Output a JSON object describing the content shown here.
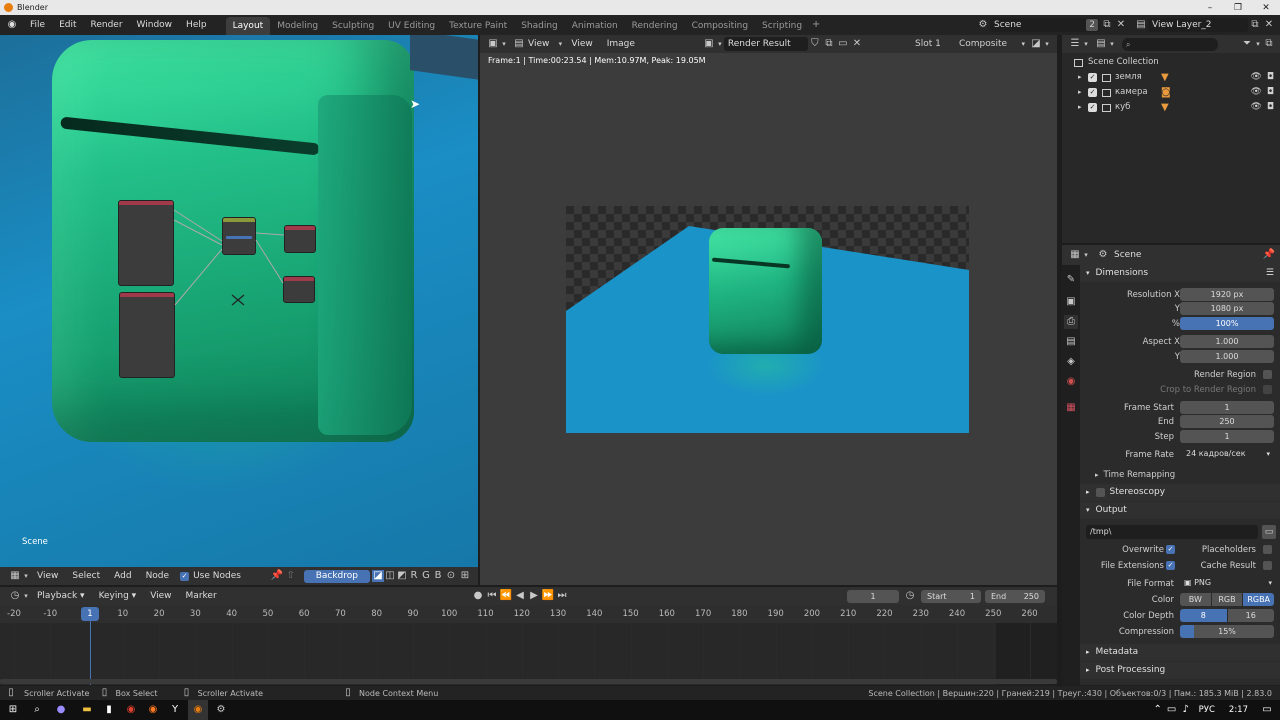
{
  "window": {
    "title": "Blender"
  },
  "menu": [
    "File",
    "Edit",
    "Render",
    "Window",
    "Help"
  ],
  "workspaces": [
    {
      "label": "Layout",
      "active": true
    },
    {
      "label": "Modeling"
    },
    {
      "label": "Sculpting"
    },
    {
      "label": "UV Editing"
    },
    {
      "label": "Texture Paint"
    },
    {
      "label": "Shading"
    },
    {
      "label": "Animation"
    },
    {
      "label": "Rendering"
    },
    {
      "label": "Compositing"
    },
    {
      "label": "Scripting"
    }
  ],
  "scene_selector": {
    "value": "Scene",
    "users": "2"
  },
  "view_layer": {
    "value": "View Layer_2"
  },
  "node_editor": {
    "scene_label": "Scene",
    "header": {
      "view": "View",
      "select": "Select",
      "add": "Add",
      "node": "Node",
      "use_nodes": "Use Nodes",
      "backdrop": "Backdrop"
    }
  },
  "image_editor": {
    "view": "View",
    "view2": "View",
    "image": "Image",
    "image_name": "Render Result",
    "slot": "Slot 1",
    "pass": "Composite",
    "info": "Frame:1 | Time:00:23.54 | Mem:10.97M, Peak: 19.05M"
  },
  "outliner": {
    "collection": "Scene Collection",
    "items": [
      {
        "name": "земля",
        "icon": "mesh"
      },
      {
        "name": "камера",
        "icon": "camera"
      },
      {
        "name": "куб",
        "icon": "mesh"
      }
    ]
  },
  "properties": {
    "context": "Scene",
    "dimensions": "Dimensions",
    "res_x_label": "Resolution X",
    "res_x": "1920 px",
    "res_y_label": "Y",
    "res_y": "1080 px",
    "res_pct_label": "%",
    "res_pct": "100%",
    "aspect_x_label": "Aspect X",
    "aspect_x": "1.000",
    "aspect_y_label": "Y",
    "aspect_y": "1.000",
    "render_region": "Render Region",
    "crop_region": "Crop to Render Region",
    "frame_start_label": "Frame Start",
    "frame_start": "1",
    "end_label": "End",
    "end": "250",
    "step_label": "Step",
    "step": "1",
    "frame_rate_label": "Frame Rate",
    "frame_rate": "24 кадров/сек",
    "time_remapping": "Time Remapping",
    "stereoscopy": "Stereoscopy",
    "output": "Output",
    "output_path": "/tmp\\",
    "overwrite": "Overwrite",
    "placeholders": "Placeholders",
    "file_extensions": "File Extensions",
    "cache_result": "Cache Result",
    "file_format_label": "File Format",
    "file_format": "PNG",
    "color_label": "Color",
    "color_bw": "BW",
    "color_rgb": "RGB",
    "color_rgba": "RGBA",
    "depth_label": "Color Depth",
    "depth_8": "8",
    "depth_16": "16",
    "compression_label": "Compression",
    "compression": "15%",
    "compression_value": 0.15,
    "metadata": "Metadata",
    "post_processing": "Post Processing"
  },
  "timeline": {
    "playback": "Playback",
    "keying": "Keying",
    "view": "View",
    "marker": "Marker",
    "current_frame": "1",
    "start_label": "Start",
    "start": "1",
    "end_label": "End",
    "end": "250",
    "ticks": [
      "-20",
      "-10",
      "1",
      "10",
      "20",
      "30",
      "40",
      "50",
      "60",
      "70",
      "80",
      "90",
      "100",
      "110",
      "120",
      "130",
      "140",
      "150",
      "160",
      "170",
      "180",
      "190",
      "200",
      "210",
      "220",
      "230",
      "240",
      "250",
      "260"
    ]
  },
  "status_bar": {
    "left1": "Scroller Activate",
    "left2": "Box Select",
    "left3": "Scroller Activate",
    "mid": "Node Context Menu",
    "stats": "Scene Collection | Вершин:220 | Граней:219 | Треуг.:430 | Объектов:0/3 | Пам.: 185.3 MiB | 2.83.0"
  },
  "taskbar": {
    "lang": "РУС",
    "time": "2:17"
  },
  "colors": {
    "accent": "#4772b3",
    "header": "#303030",
    "panel": "#2b2b2b",
    "cube": "#23c08a",
    "floor": "#1f8fc4"
  }
}
